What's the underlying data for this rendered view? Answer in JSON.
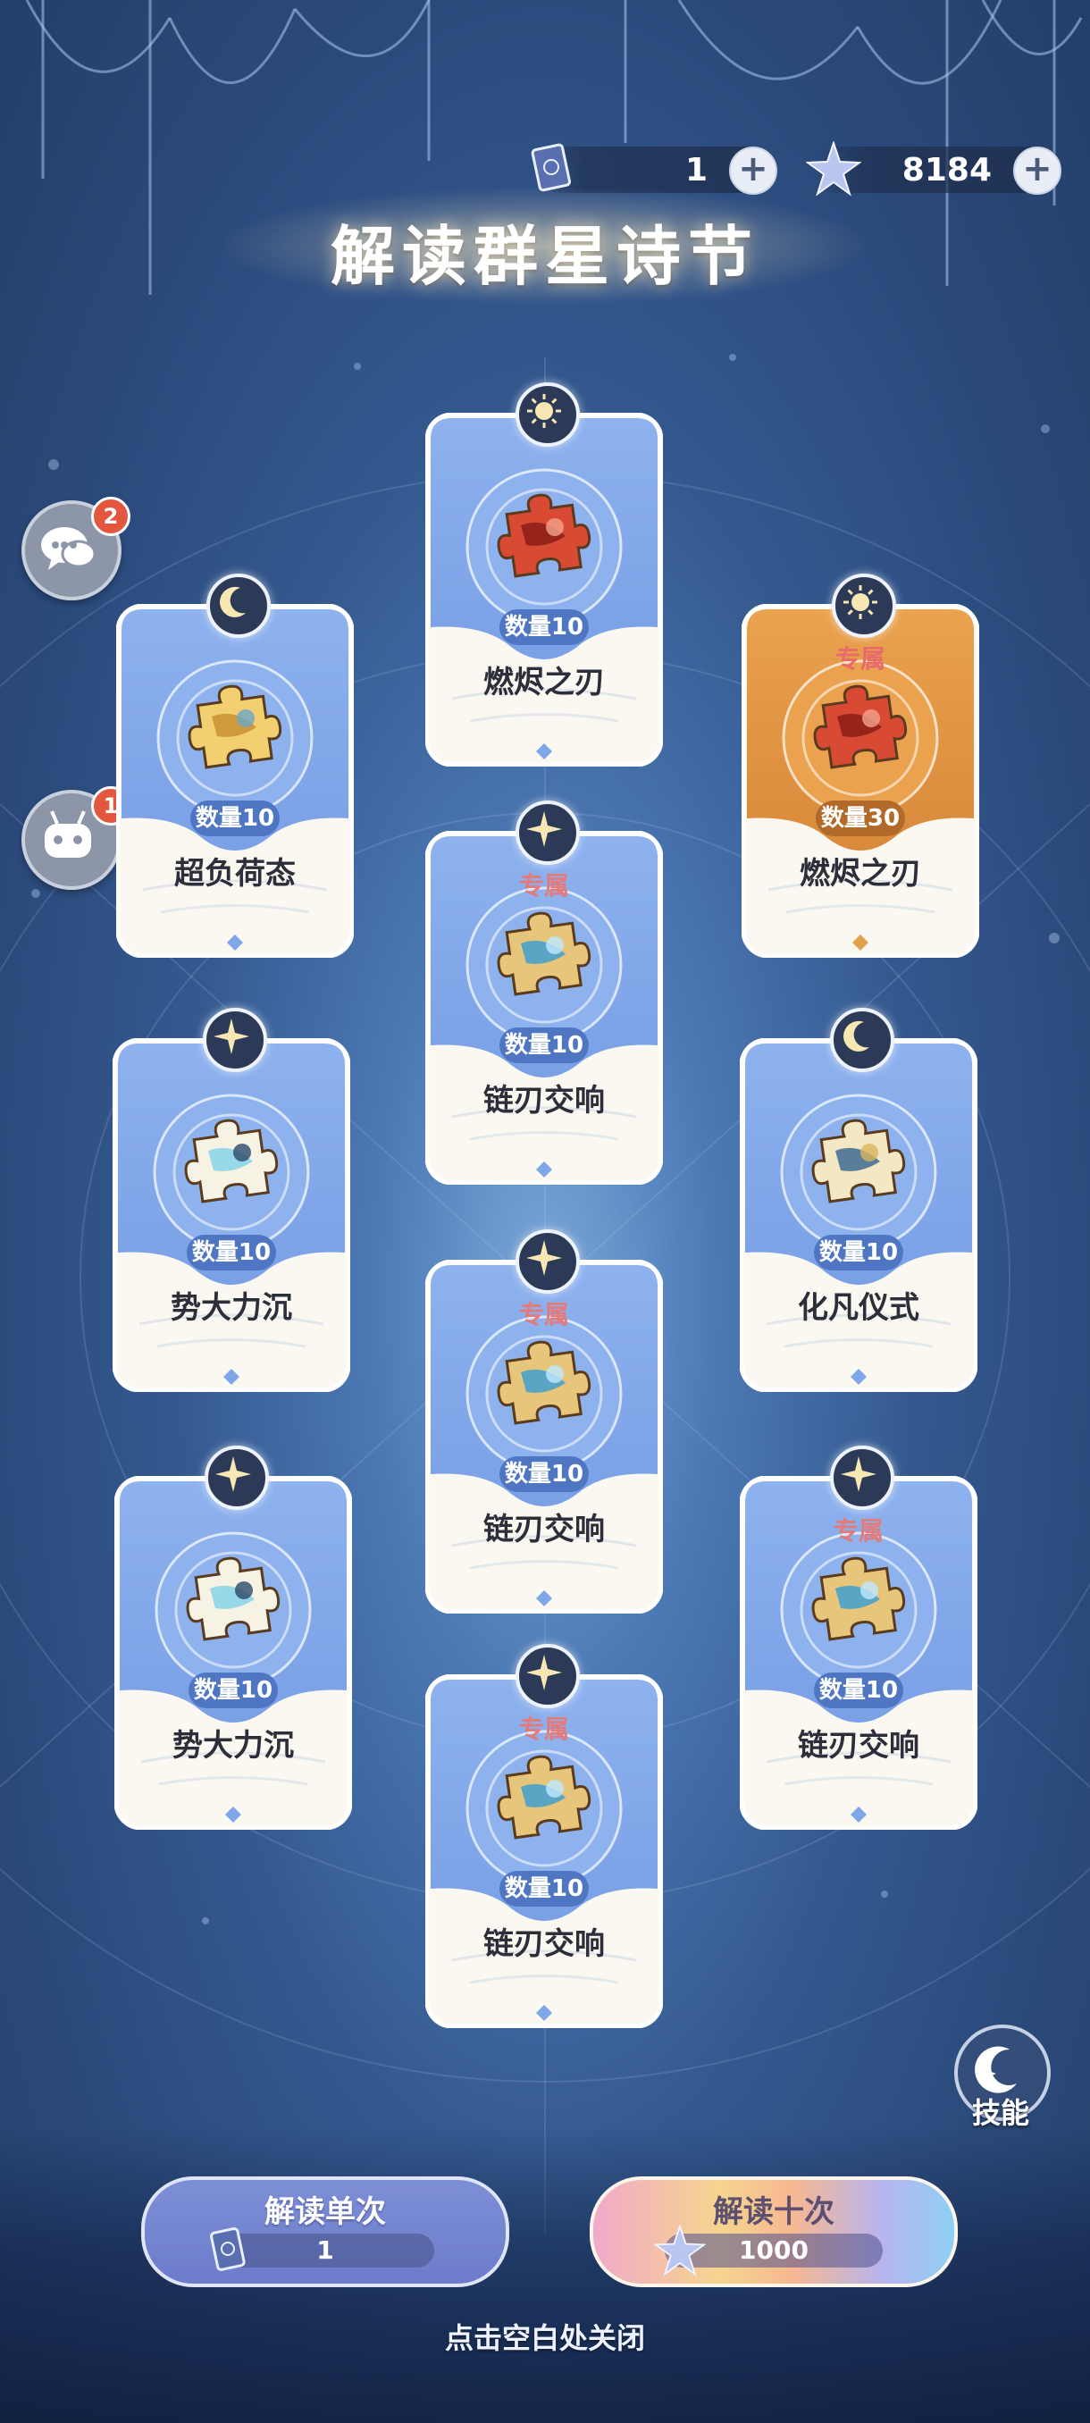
{
  "currencies": {
    "pass": {
      "value": "1",
      "icon": "card-pass-icon"
    },
    "stars": {
      "value": "8184",
      "icon": "starglitter-icon"
    },
    "plus": "+"
  },
  "title": "解读群星诗节",
  "side_buttons": {
    "chat": {
      "icon": "chat-bubble-icon",
      "badge": "2"
    },
    "bot": {
      "icon": "robot-icon",
      "badge": "1"
    }
  },
  "cards": [
    {
      "emblem": "sun-emblem-icon",
      "exclusive": "",
      "qty": "数量10",
      "name": "燃烬之刃",
      "style": "blue",
      "puzzle": "red"
    },
    {
      "emblem": "moon-emblem-icon",
      "exclusive": "",
      "qty": "数量10",
      "name": "超负荷态",
      "style": "blue",
      "puzzle": "gold"
    },
    {
      "emblem": "sun-emblem-icon",
      "exclusive": "专属",
      "qty": "数量30",
      "name": "燃烬之刃",
      "style": "gold",
      "puzzle": "red"
    },
    {
      "emblem": "star-emblem-icon",
      "exclusive": "专属",
      "qty": "数量10",
      "name": "链刃交响",
      "style": "blue",
      "puzzle": "cyan"
    },
    {
      "emblem": "star-emblem-icon",
      "exclusive": "",
      "qty": "数量10",
      "name": "势大力沉",
      "style": "blue",
      "puzzle": "white"
    },
    {
      "emblem": "moon-emblem-icon",
      "exclusive": "",
      "qty": "数量10",
      "name": "化凡仪式",
      "style": "blue",
      "puzzle": "cream"
    },
    {
      "emblem": "star-emblem-icon",
      "exclusive": "专属",
      "qty": "数量10",
      "name": "链刃交响",
      "style": "blue",
      "puzzle": "cyan"
    },
    {
      "emblem": "star-emblem-icon",
      "exclusive": "",
      "qty": "数量10",
      "name": "势大力沉",
      "style": "blue",
      "puzzle": "white"
    },
    {
      "emblem": "star-emblem-icon",
      "exclusive": "专属",
      "qty": "数量10",
      "name": "链刃交响",
      "style": "blue",
      "puzzle": "cyan"
    },
    {
      "emblem": "star-emblem-icon",
      "exclusive": "专属",
      "qty": "数量10",
      "name": "链刃交响",
      "style": "blue",
      "puzzle": "cyan"
    }
  ],
  "skill": {
    "label": "技能",
    "icon": "moon-sparkle-icon"
  },
  "actions": {
    "single": {
      "label": "解读单次",
      "cost": "1",
      "cost_icon": "card-pass-icon"
    },
    "ten": {
      "label": "解读十次",
      "cost": "1000",
      "cost_icon": "starglitter-icon"
    }
  },
  "close_hint": "点击空白处关闭",
  "colors": {
    "background": "#34598f",
    "card_blue": "#8eb2ee",
    "card_gold": "#e9a24d",
    "qty_badge": "#4f76c2",
    "exclusive_text": "#e37b7b"
  }
}
